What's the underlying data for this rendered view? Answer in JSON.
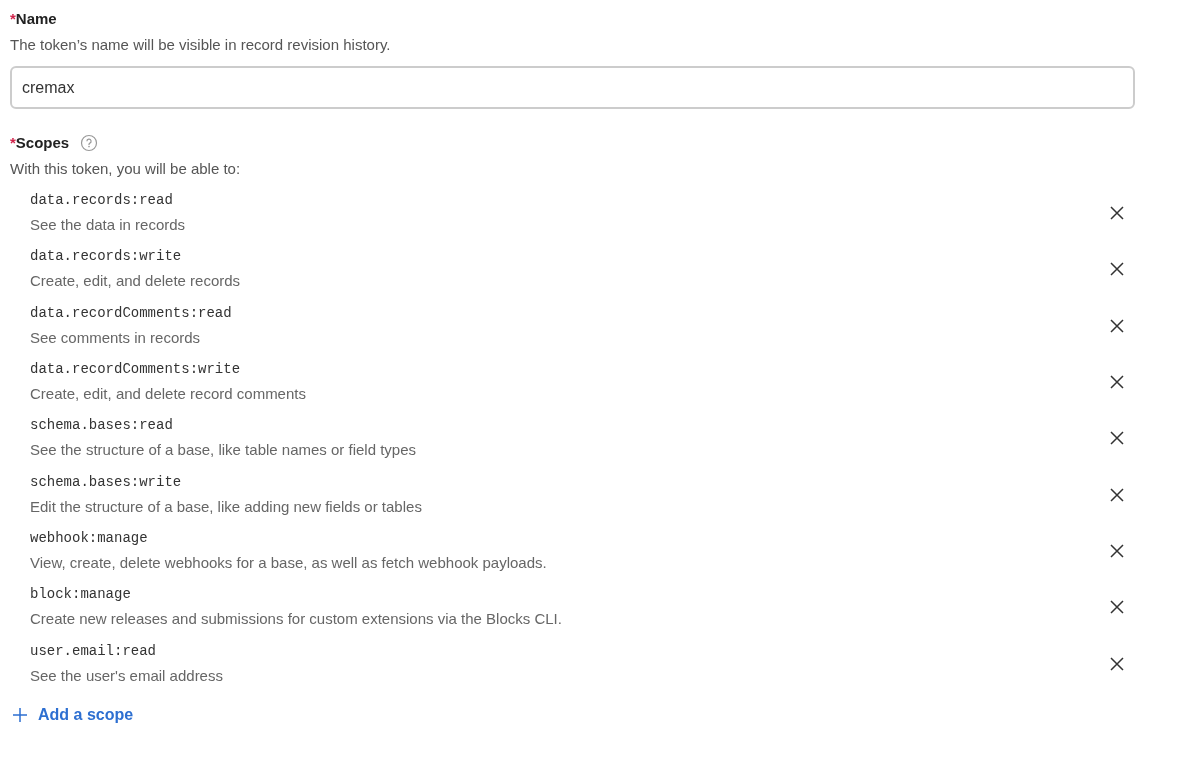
{
  "name_field": {
    "required_mark": "*",
    "label": "Name",
    "description": "The token’s name will be visible in record revision history.",
    "value": "cremax"
  },
  "scopes": {
    "required_mark": "*",
    "label": "Scopes",
    "description": "With this token, you will be able to:",
    "items": [
      {
        "code": "data.records:read",
        "description": "See the data in records"
      },
      {
        "code": "data.records:write",
        "description": "Create, edit, and delete records"
      },
      {
        "code": "data.recordComments:read",
        "description": "See comments in records"
      },
      {
        "code": "data.recordComments:write",
        "description": "Create, edit, and delete record comments"
      },
      {
        "code": "schema.bases:read",
        "description": "See the structure of a base, like table names or field types"
      },
      {
        "code": "schema.bases:write",
        "description": "Edit the structure of a base, like adding new fields or tables"
      },
      {
        "code": "webhook:manage",
        "description": "View, create, delete webhooks for a base, as well as fetch webhook payloads."
      },
      {
        "code": "block:manage",
        "description": "Create new releases and submissions for custom extensions via the Blocks CLI."
      },
      {
        "code": "user.email:read",
        "description": "See the user's email address"
      }
    ],
    "add_label": "Add a scope"
  }
}
